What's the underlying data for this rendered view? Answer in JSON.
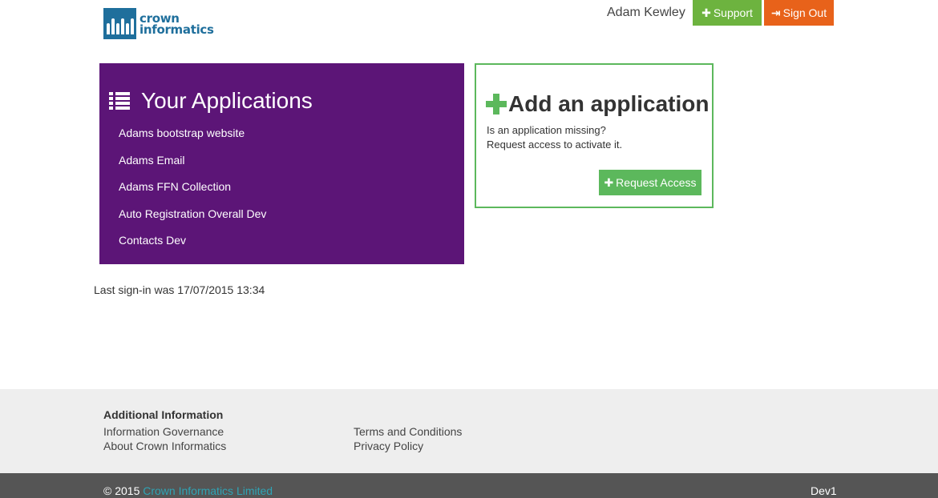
{
  "brand": {
    "line1": "crown",
    "line2": "informatics",
    "color": "#1f6f9c"
  },
  "header": {
    "user_name": "Adam Kewley",
    "support_label": "Support",
    "signout_label": "Sign Out",
    "support_color": "#6db33f",
    "signout_color": "#e8621a"
  },
  "applications": {
    "title": "Your Applications",
    "panel_color": "#5c1577",
    "items": [
      {
        "label": "Adams bootstrap website"
      },
      {
        "label": "Adams Email"
      },
      {
        "label": "Adams FFN Collection"
      },
      {
        "label": "Auto Registration Overall Dev"
      },
      {
        "label": "Contacts Dev"
      }
    ]
  },
  "add_application": {
    "title": "Add an application",
    "description_line1": "Is an application missing?",
    "description_line2": "Request access to activate it.",
    "button_label": "Request Access",
    "accent_color": "#5cb85c"
  },
  "last_signin": "Last sign-in was 17/07/2015 13:34",
  "footer": {
    "heading": "Additional Information",
    "left_links": [
      {
        "label": "Information Governance"
      },
      {
        "label": "About Crown Informatics"
      }
    ],
    "right_links": [
      {
        "label": "Terms and Conditions"
      },
      {
        "label": "Privacy Policy"
      }
    ]
  },
  "bottom_bar": {
    "copyright_prefix": "© 2015",
    "copyright_link": "Crown Informatics Limited",
    "environment": "Dev1"
  }
}
